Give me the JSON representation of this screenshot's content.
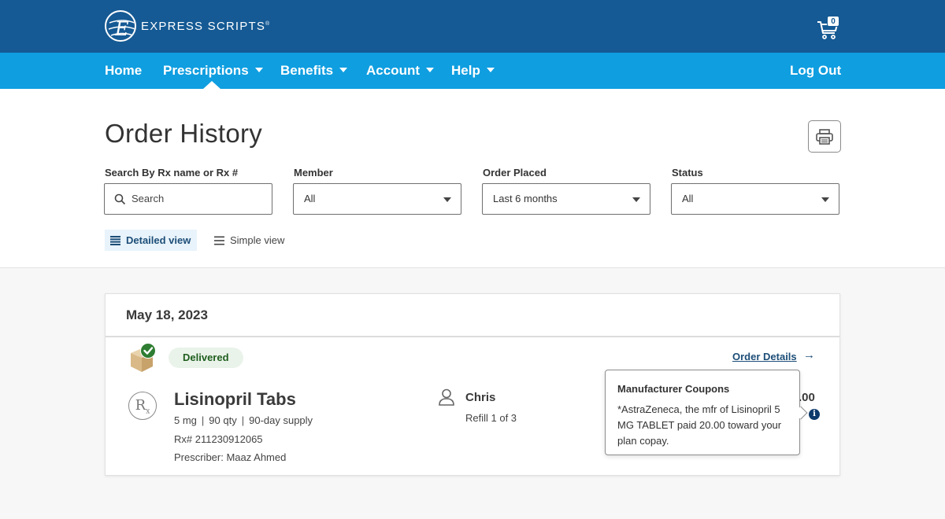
{
  "brand": {
    "name": "EXPRESS SCRIPTS",
    "mark": "®",
    "logo_icon": "express-scripts-globe-icon"
  },
  "cart": {
    "icon": "cart-icon",
    "count": "0"
  },
  "nav": {
    "items": [
      {
        "label": "Home"
      },
      {
        "label": "Prescriptions"
      },
      {
        "label": "Benefits"
      },
      {
        "label": "Account"
      },
      {
        "label": "Help"
      }
    ],
    "logout": "Log Out"
  },
  "page": {
    "title": "Order History",
    "print_icon": "printer-icon"
  },
  "filters": {
    "search": {
      "label": "Search By Rx name or Rx #",
      "placeholder": "Search"
    },
    "member": {
      "label": "Member",
      "value": "All"
    },
    "order_placed": {
      "label": "Order Placed",
      "value": "Last 6 months"
    },
    "status": {
      "label": "Status",
      "value": "All"
    }
  },
  "views": {
    "detailed": "Detailed view",
    "simple": "Simple view"
  },
  "order": {
    "date": "May 18, 2023",
    "status": "Delivered",
    "details_link": "Order Details",
    "arrow": "→",
    "item": {
      "rx_symbol": "R",
      "rx_sub": "x",
      "name": "Lisinopril Tabs",
      "strength": "5 mg",
      "qty": "90 qty",
      "supply": "90-day supply",
      "rx_number": "Rx# 211230912065",
      "prescriber": "Prescriber: Maaz Ahmed",
      "member": "Chris",
      "refill": "Refill 1 of 3",
      "price_partial": ".00",
      "info_glyph": "i"
    }
  },
  "tooltip": {
    "title": "Manufacturer Coupons",
    "body": "*AstraZeneca, the mfr of Lisinopril 5 MG TABLET paid 20.00 toward your plan copay."
  },
  "colors": {
    "topbar": "#155a94",
    "navbar": "#0f9ee0",
    "delivered_badge": "#eaf3ea",
    "link": "#1d4e78"
  }
}
